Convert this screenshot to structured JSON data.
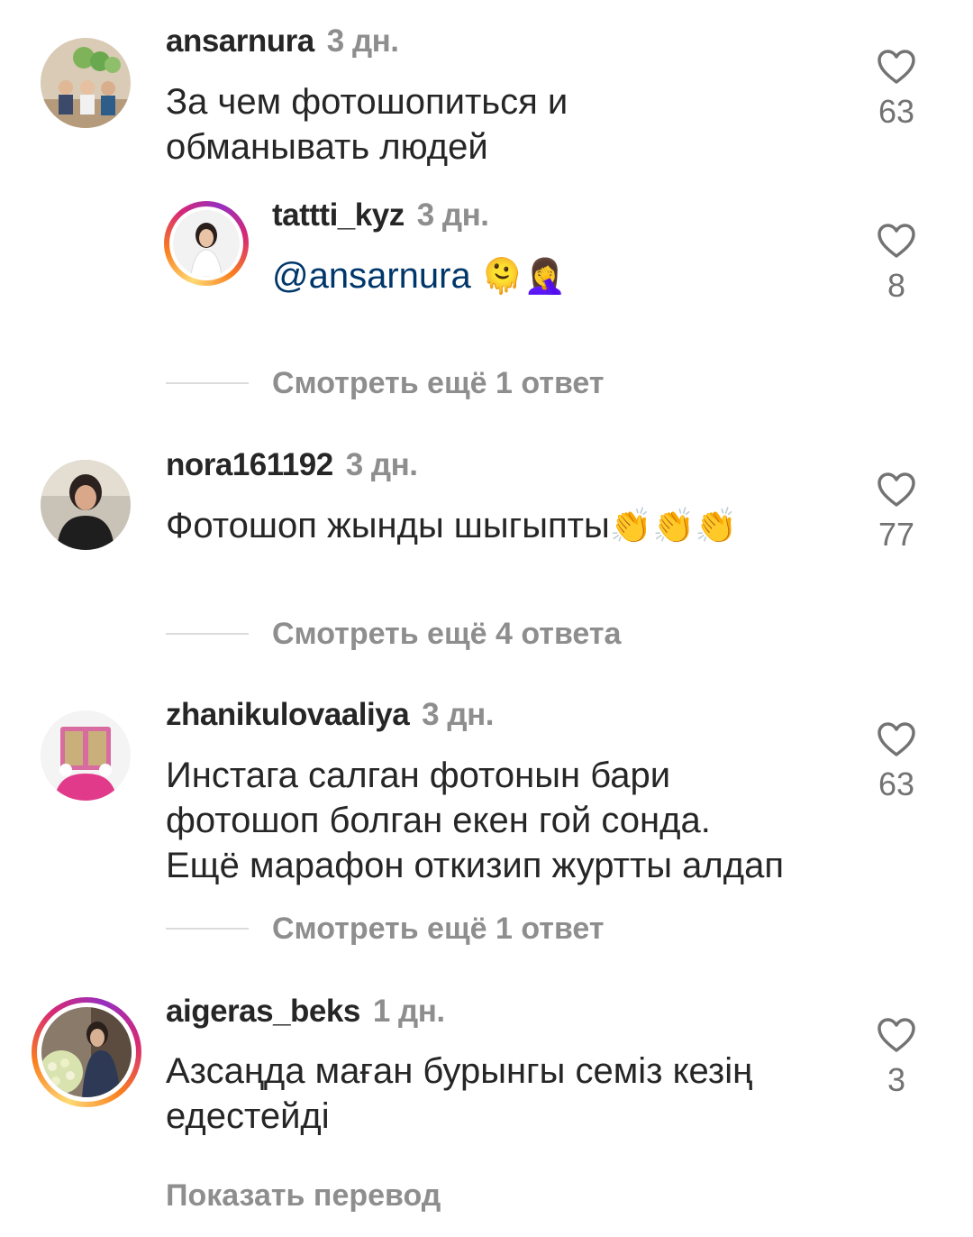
{
  "comments": [
    {
      "username": "ansarnura",
      "time": "3 дн.",
      "text_lines": [
        "За чем фотошопиться и",
        "обманывать людей"
      ],
      "likes": "63",
      "reply": {
        "username": "tattti_kyz",
        "time": "3 дн.",
        "mention": "@ansarnura",
        "emoji": "🫠🤦‍♀️",
        "likes": "8"
      },
      "view_more": "Смотреть ещё 1 ответ"
    },
    {
      "username": "nora161192",
      "time": "3 дн.",
      "text": "Фотошоп жынды шыгыпты",
      "emoji": "👏👏👏",
      "likes": "77",
      "view_more": "Смотреть ещё 4 ответа"
    },
    {
      "username": "zhanikulovaaliya",
      "time": "3 дн.",
      "text_lines": [
        "Инстага салган фотонын бари",
        "фотошоп болган екен гой сонда.",
        "Ещё марафон откизип журтты алдап"
      ],
      "likes": "63",
      "view_more": "Смотреть ещё 1 ответ"
    },
    {
      "username": "aigeras_beks",
      "time": "1 дн.",
      "text_lines": [
        "Азсаңда маған бурынгы семіз кезің",
        "едестейді"
      ],
      "likes": "3",
      "show_translation": "Показать перевод"
    }
  ],
  "icons": {
    "like": "heart-outline-icon"
  },
  "colors": {
    "mention": "#00376b",
    "meta": "#8e8e8e",
    "text": "#262626"
  }
}
